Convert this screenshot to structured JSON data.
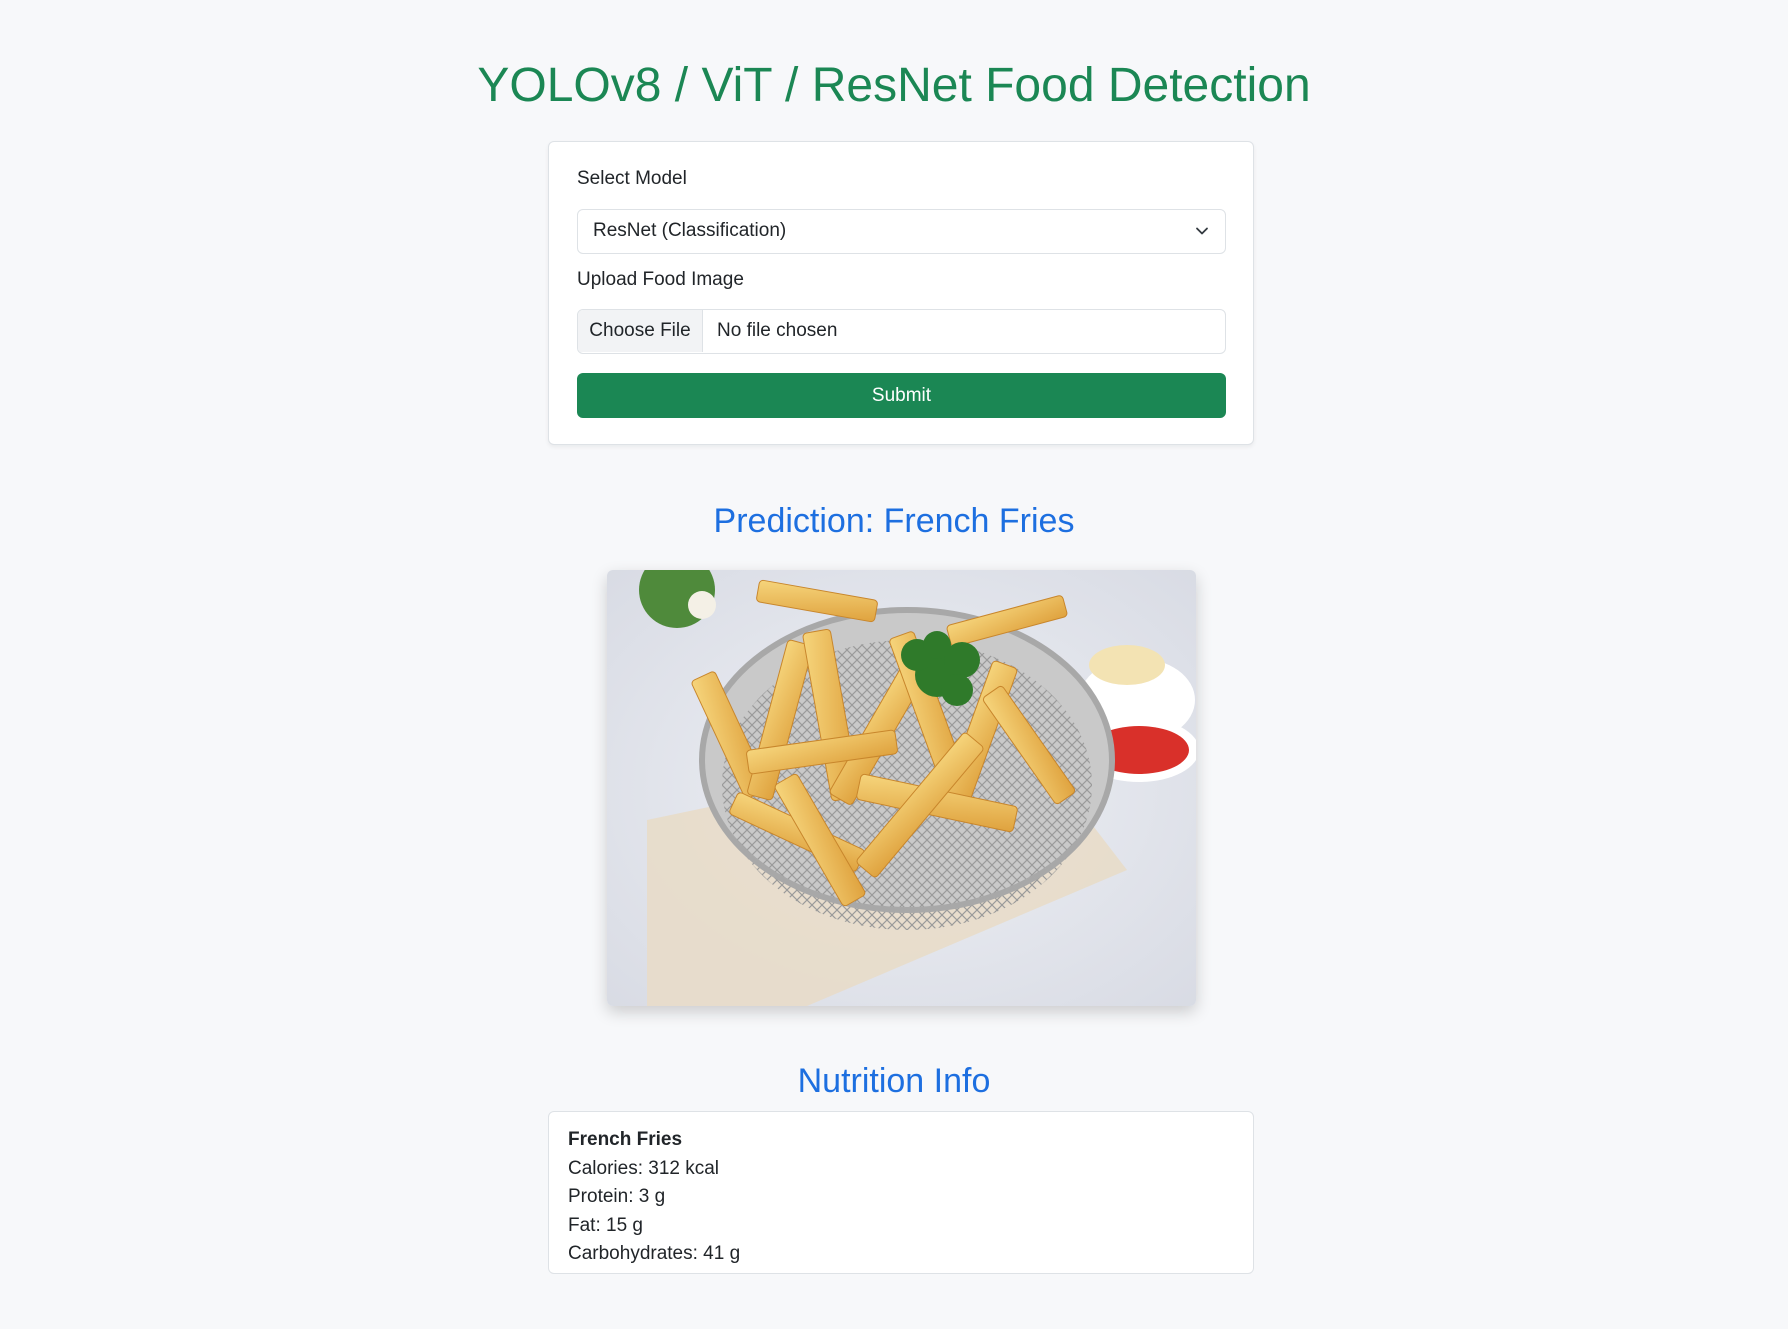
{
  "page": {
    "title": "YOLOv8 / ViT / ResNet Food Detection"
  },
  "form": {
    "model_label": "Select Model",
    "model_selected": "ResNet (Classification)",
    "upload_label": "Upload Food Image",
    "file_button": "Choose File",
    "file_status": "No file chosen",
    "submit_label": "Submit"
  },
  "result": {
    "prediction_heading": "Prediction: French Fries",
    "image_icon": "french-fries-photo"
  },
  "nutrition": {
    "heading": "Nutrition Info",
    "food_name": "French Fries",
    "calories": "Calories: 312 kcal",
    "protein": "Protein: 3 g",
    "fat": "Fat: 15 g",
    "carbs": "Carbohydrates: 41 g"
  },
  "colors": {
    "primary_green": "#1b8754",
    "heading_blue": "#1d6fe0",
    "background": "#f7f8fa"
  }
}
